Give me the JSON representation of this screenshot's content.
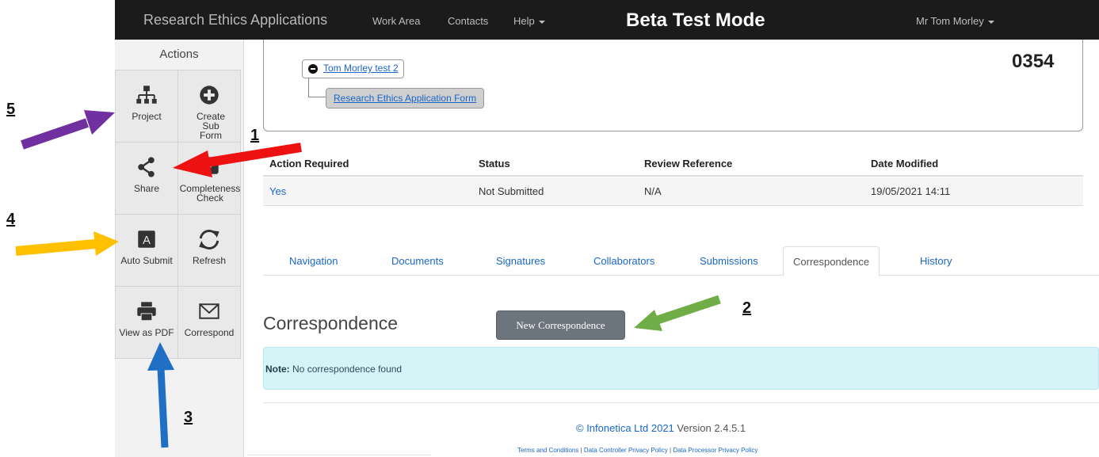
{
  "navbar": {
    "brand": "Research Ethics Applications",
    "work_area": "Work Area",
    "contacts": "Contacts",
    "help": "Help",
    "mode_banner": "Beta Test Mode",
    "user": "Mr Tom Morley"
  },
  "sidebar": {
    "heading": "Actions",
    "tiles": {
      "project": "Project",
      "create_sub_form": "Create Sub Form",
      "share": "Share",
      "completeness_check": "Completeness Check",
      "auto_submit": "Auto Submit",
      "refresh": "Refresh",
      "view_as_pdf": "View as PDF",
      "correspond": "Correspond"
    }
  },
  "project_tree": {
    "root_label": "Tom Morley test 2",
    "child_label": "Research Ethics Application Form",
    "project_number": "0354"
  },
  "status_table": {
    "headers": [
      "Action Required",
      "Status",
      "Review Reference",
      "Date Modified"
    ],
    "row": [
      "Yes",
      "Not Submitted",
      "N/A",
      "19/05/2021 14:11"
    ]
  },
  "tabs": {
    "navigation": "Navigation",
    "documents": "Documents",
    "signatures": "Signatures",
    "collaborators": "Collaborators",
    "submissions": "Submissions",
    "correspondence": "Correspondence",
    "history": "History",
    "active": "Correspondence"
  },
  "correspondence": {
    "title": "Correspondence",
    "new_button": "New Correspondence",
    "note_label": "Note:",
    "note_text": "No correspondence found"
  },
  "footer": {
    "copyright": "© Infonetica Ltd 2021",
    "version": "Version 2.4.5.1",
    "links": [
      "Terms and Conditions",
      "Data Controller Privacy Policy",
      "Data Processor Privacy Policy"
    ]
  },
  "annotations": {
    "markers": [
      "1",
      "2",
      "3",
      "4",
      "5"
    ],
    "colors": {
      "marker_1": "#ee1111",
      "marker_2": "#70ad47",
      "marker_3": "#1f6fc5",
      "marker_4": "#ffc000",
      "marker_5": "#7030a0"
    }
  }
}
